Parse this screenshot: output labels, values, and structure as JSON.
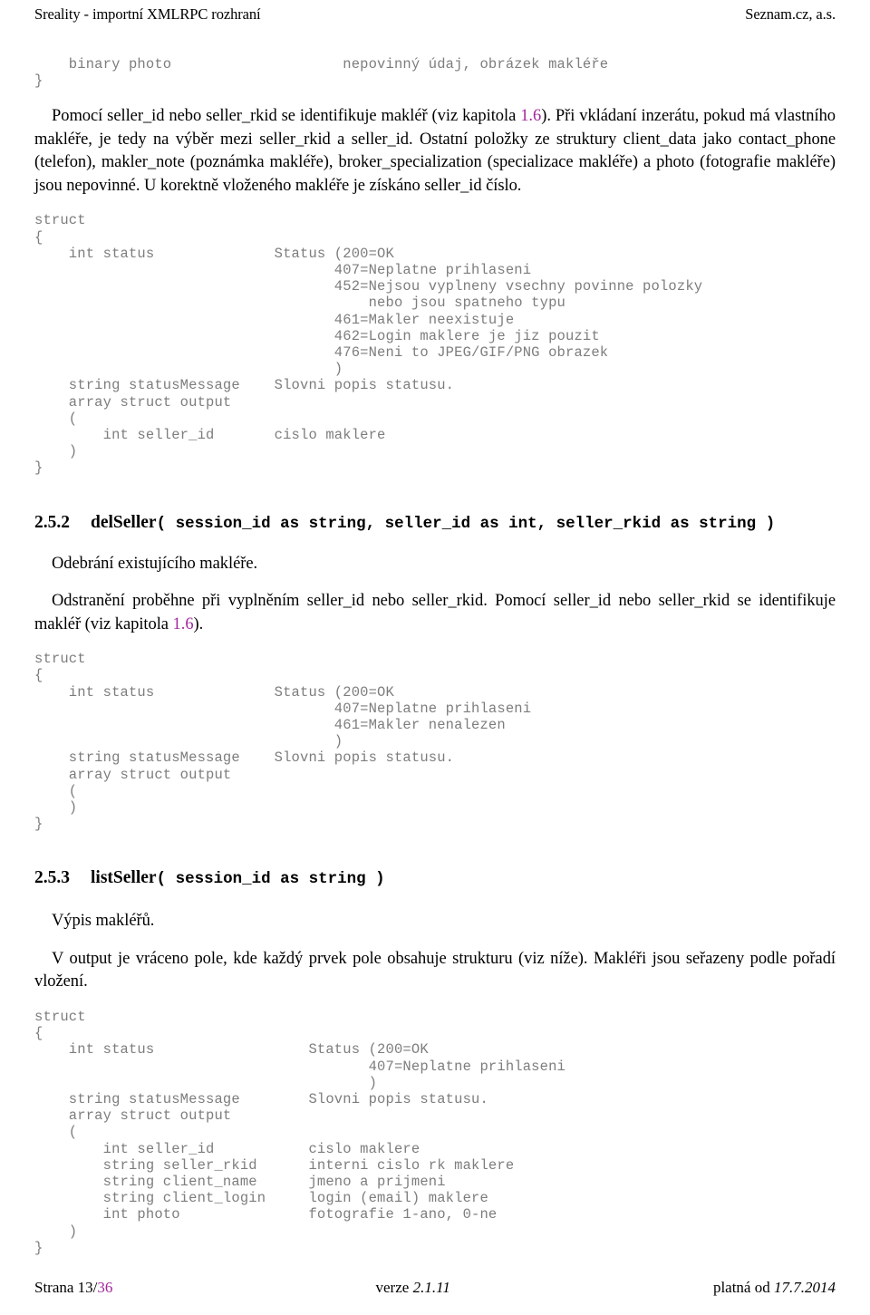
{
  "header": {
    "left": "Sreality - importní XMLRPC rozhraní",
    "right": "Seznam.cz, a.s."
  },
  "footer": {
    "left_prefix": "Strana 13/",
    "left_link": "36",
    "center_label": "verze ",
    "center_value": "2.1.11",
    "right_label": "platná od ",
    "right_value": "17.7.2014"
  },
  "colors": {
    "link": "#a0289b",
    "code": "#7d7d7d",
    "text": "#000000",
    "background": "#ffffff"
  },
  "content": {
    "code_block_top": "    binary photo                    nepovinný údaj, obrázek makléře\n}",
    "paragraph_1": {
      "part_a": "Pomocí seller_id nebo seller_rkid se identifikuje makléř (viz kapitola ",
      "link": "1.6",
      "part_b": ").  Při vkládaní inzerátu, pokud má vlastního makléře, je tedy na výběr mezi seller_rkid a seller_id.  Ostatní položky ze struktury client_data jako contact_phone (telefon), makler_note (poznámka makléře), broker_specialization (specializace makléře) a photo (fotografie makléře) jsou nepovinné. U korektně vloženého makléře je získáno seller_id číslo."
    },
    "code_block_1": "struct\n{\n    int status              Status (200=OK\n                                   407=Neplatne prihlaseni\n                                   452=Nejsou vyplneny vsechny povinne polozky\n                                       nebo jsou spatneho typu\n                                   461=Makler neexistuje\n                                   462=Login maklere je jiz pouzit\n                                   476=Neni to JPEG/GIF/PNG obrazek\n                                   )\n    string statusMessage    Slovni popis statusu.\n    array struct output\n    (\n        int seller_id       cislo maklere\n    )\n}",
    "section_252": {
      "number": "2.5.2",
      "name": "delSeller",
      "signature": "( session_id as string, seller_id as int, seller_rkid as string )"
    },
    "paragraph_2": "Odebrání existujícího makléře.",
    "paragraph_3": {
      "part_a": "Odstranění proběhne při vyplněním seller_id nebo seller_rkid. Pomocí seller_id nebo seller_rkid se identifikuje makléř (viz kapitola ",
      "link": "1.6",
      "part_b": ")."
    },
    "code_block_2": "struct\n{\n    int status              Status (200=OK\n                                   407=Neplatne prihlaseni\n                                   461=Makler nenalezen\n                                   )\n    string statusMessage    Slovni popis statusu.\n    array struct output\n    (\n    )\n}",
    "section_253": {
      "number": "2.5.3",
      "name": "listSeller",
      "signature": "( session_id as string )"
    },
    "paragraph_4": "Výpis makléřů.",
    "paragraph_5": "V output je vráceno pole, kde každý prvek pole obsahuje strukturu (viz níže). Makléři jsou seřazeny podle pořadí vložení.",
    "code_block_3": "struct\n{\n    int status                  Status (200=OK\n                                       407=Neplatne prihlaseni\n                                       )\n    string statusMessage        Slovni popis statusu.\n    array struct output\n    (\n        int seller_id           cislo maklere\n        string seller_rkid      interni cislo rk maklere\n        string client_name      jmeno a prijmeni\n        string client_login     login (email) maklere\n        int photo               fotografie 1-ano, 0-ne\n    )\n}"
  }
}
